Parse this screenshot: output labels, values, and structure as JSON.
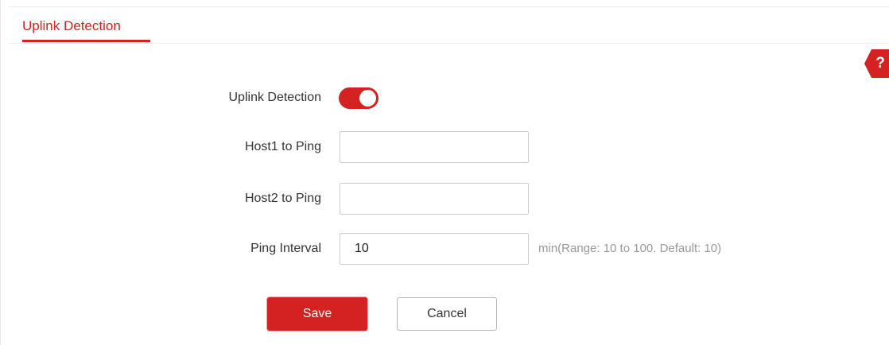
{
  "tab": {
    "title": "Uplink Detection"
  },
  "help": {
    "icon": "help-icon",
    "symbol": "?"
  },
  "form": {
    "uplink_detection": {
      "label": "Uplink Detection",
      "enabled": true
    },
    "host1": {
      "label": "Host1 to Ping",
      "value": ""
    },
    "host2": {
      "label": "Host2 to Ping",
      "value": ""
    },
    "ping_interval": {
      "label": "Ping Interval",
      "value": "10",
      "hint": "min(Range: 10 to 100. Default: 10)"
    }
  },
  "actions": {
    "save_label": "Save",
    "cancel_label": "Cancel"
  },
  "colors": {
    "accent": "#d42121",
    "hint_text": "#999999"
  }
}
